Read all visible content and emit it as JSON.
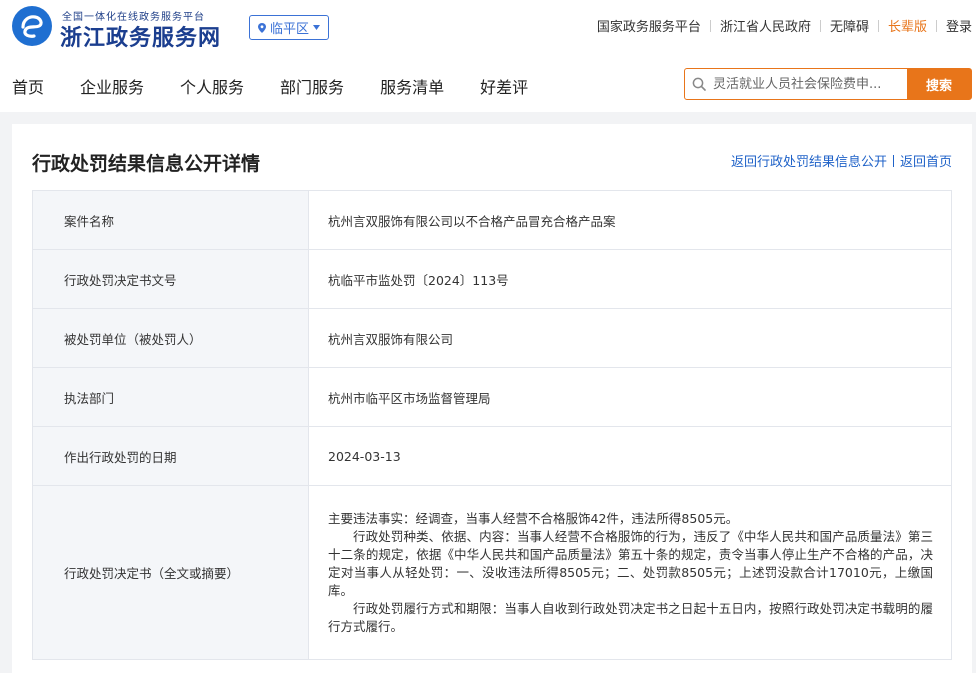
{
  "header": {
    "logo_subtitle": "全国一体化在线政务服务平台",
    "logo_title": "浙江政务服务网",
    "region": "临平区",
    "top_links": [
      "国家政务服务平台",
      "浙江省人民政府",
      "无障碍",
      "长辈版",
      "登录"
    ],
    "nav_items": [
      "首页",
      "企业服务",
      "个人服务",
      "部门服务",
      "服务清单",
      "好差评"
    ],
    "search_placeholder": "灵活就业人员社会保险费申...",
    "search_button": "搜索"
  },
  "page": {
    "title": "行政处罚结果信息公开详情",
    "back_list": "返回行政处罚结果信息公开",
    "back_home": "返回首页"
  },
  "details": [
    {
      "label": "案件名称",
      "value": "杭州言双服饰有限公司以不合格产品冒充合格产品案"
    },
    {
      "label": "行政处罚决定书文号",
      "value": "杭临平市监处罚〔2024〕113号"
    },
    {
      "label": "被处罚单位（被处罚人）",
      "value": "杭州言双服饰有限公司"
    },
    {
      "label": "执法部门",
      "value": "杭州市临平区市场监督管理局"
    },
    {
      "label": "作出行政处罚的日期",
      "value": "2024-03-13"
    }
  ],
  "decision": {
    "label": "行政处罚决定书（全文或摘要）",
    "paragraphs": [
      "主要违法事实：经调查，当事人经营不合格服饰42件，违法所得8505元。",
      "行政处罚种类、依据、内容：当事人经营不合格服饰的行为，违反了《中华人民共和国产品质量法》第三十二条的规定，依据《中华人民共和国产品质量法》第五十条的规定，责令当事人停止生产不合格的产品，决定对当事人从轻处罚：一、没收违法所得8505元；二、处罚款8505元；上述罚没款合计17010元，上缴国库。",
      "行政处罚履行方式和期限：当事人自收到行政处罚决定书之日起十五日内，按照行政处罚决定书载明的履行方式履行。"
    ]
  },
  "colors": {
    "brand_blue": "#1f6fd1",
    "accent_orange": "#e8751a",
    "link_blue": "#1f62c8"
  },
  "icons": {
    "logo": "zhejiang-logo-icon",
    "region": "location-pin-icon",
    "dropdown": "caret-down-icon",
    "search": "search-icon"
  }
}
